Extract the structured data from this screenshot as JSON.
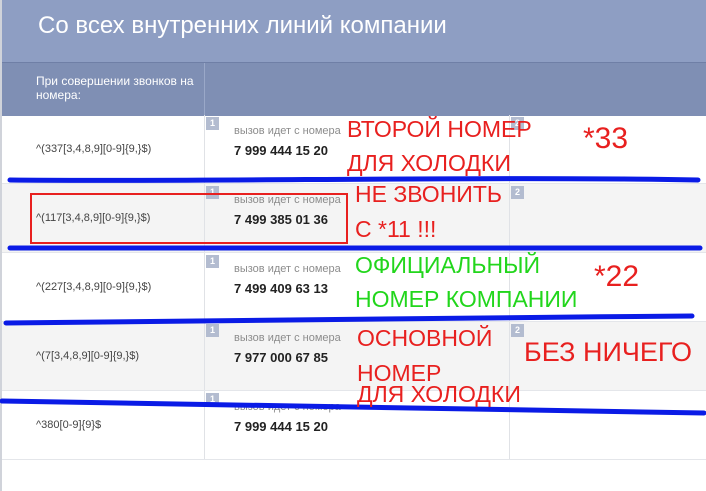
{
  "header": {
    "title": "Со всех внутренних линий компании"
  },
  "subheader": {
    "label": "При совершении звонков на номера:"
  },
  "rows": [
    {
      "pattern": "^(337[3,4,8,9][0-9]{9,}$)",
      "badge_left": "1",
      "badge_right": "2",
      "caller_label": "вызов идет с номера",
      "phone": "7 999 444 15 20"
    },
    {
      "pattern": "^(117[3,4,8,9][0-9]{9,}$)",
      "badge_left": "1",
      "badge_right": "2",
      "caller_label": "вызов идет с номера",
      "phone": "7 499 385 01 36"
    },
    {
      "pattern": "^(227[3,4,8,9][0-9]{9,}$)",
      "badge_left": "1",
      "badge_right": "",
      "caller_label": "вызов идет с номера",
      "phone": "7 499 409 63 13"
    },
    {
      "pattern": "^(7[3,4,8,9][0-9]{9,}$)",
      "badge_left": "1",
      "badge_right": "2",
      "caller_label": "вызов идет с номера",
      "phone": "7 977 000 67 85"
    },
    {
      "pattern": "^380[0-9]{9}$",
      "badge_left": "1",
      "badge_right": "",
      "caller_label": "вызов идет с номера",
      "phone": "7 999 444 15 20"
    }
  ],
  "annotations": {
    "row1_line1": "ВТОРОЙ НОМЕР",
    "row1_line2": "ДЛЯ ХОЛОДКИ",
    "row1_code": "*33",
    "row2_line1": "НЕ ЗВОНИТЬ",
    "row2_line2": "С *11 !!!",
    "row3_line1": "ОФИЦИАЛЬНЫЙ",
    "row3_line2": "НОМЕР КОМПАНИИ",
    "row3_code": "*22",
    "row4_line1": "ОСНОВНОЙ",
    "row4_line2": "НОМЕР",
    "row4_line3": "ДЛЯ ХОЛОДКИ",
    "row4_extra": "БЕЗ НИЧЕГО"
  },
  "colors": {
    "header": "#8e9ec3",
    "subheader": "#7f8fb4",
    "annotation_red": "#e8201f",
    "annotation_green": "#22d61c",
    "strike_blue": "#0a1be6"
  }
}
